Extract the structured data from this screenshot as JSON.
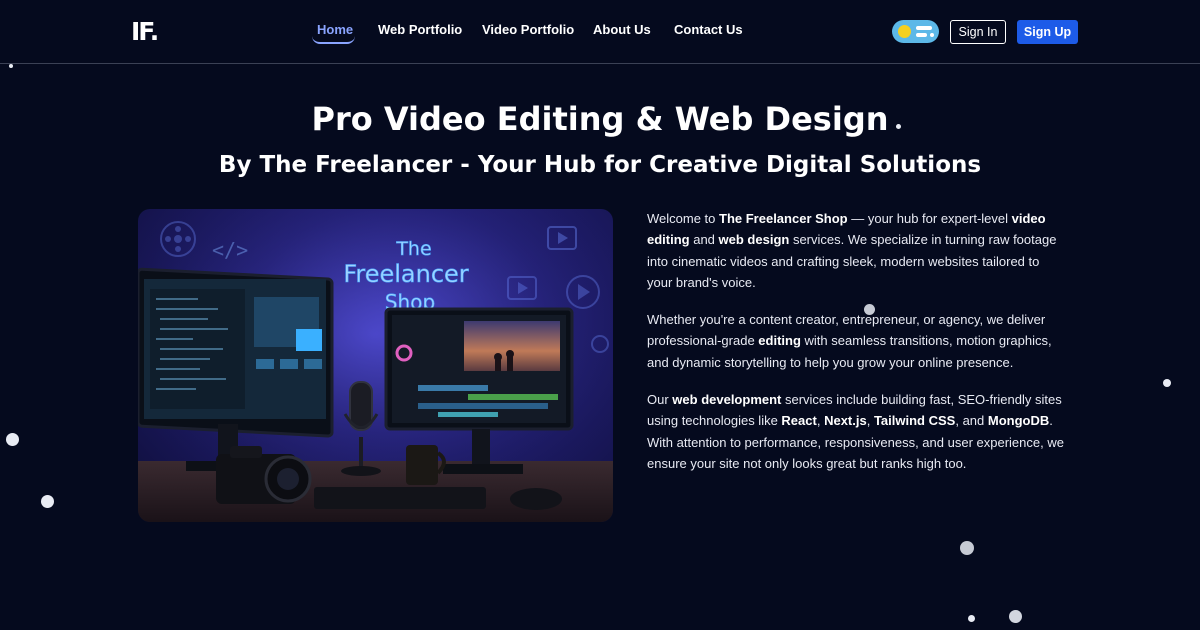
{
  "header": {
    "logo": "IF.",
    "nav": [
      {
        "label": "Home",
        "active": true
      },
      {
        "label": "Web Portfolio",
        "active": false
      },
      {
        "label": "Video Portfolio",
        "active": false
      },
      {
        "label": "About Us",
        "active": false
      },
      {
        "label": "Contact Us",
        "active": false
      }
    ],
    "signin_label": "Sign In",
    "signup_label": "Sign Up"
  },
  "hero": {
    "title": "Pro Video Editing & Web Design",
    "subtitle": "By The Freelancer - Your Hub for Creative Digital Solutions",
    "image_sign": [
      "The",
      "Freelancer",
      "Shop"
    ]
  },
  "about": {
    "p1": [
      {
        "t": "Welcome to "
      },
      {
        "t": "The Freelancer Shop",
        "b": true
      },
      {
        "t": " — your hub for expert-level "
      },
      {
        "t": "video editing",
        "b": true
      },
      {
        "t": " and "
      },
      {
        "t": "web design",
        "b": true
      },
      {
        "t": " services. We specialize in turning raw footage into cinematic videos and crafting sleek, modern websites tailored to your brand's voice."
      }
    ],
    "p2": [
      {
        "t": "Whether you're a content creator, entrepreneur, or agency, we deliver professional-grade "
      },
      {
        "t": "editing",
        "b": true
      },
      {
        "t": " with seamless transitions, motion graphics, and dynamic storytelling to help you grow your online presence."
      }
    ],
    "p3": [
      {
        "t": "Our "
      },
      {
        "t": "web development",
        "b": true
      },
      {
        "t": " services include building fast, SEO-friendly sites using technologies like "
      },
      {
        "t": "React",
        "b": true
      },
      {
        "t": ", "
      },
      {
        "t": "Next.js",
        "b": true
      },
      {
        "t": ", "
      },
      {
        "t": "Tailwind CSS",
        "b": true
      },
      {
        "t": ", and "
      },
      {
        "t": "MongoDB",
        "b": true
      },
      {
        "t": ". With attention to performance, responsiveness, and user experience, we ensure your site not only looks great but ranks high too."
      }
    ]
  },
  "colors": {
    "background": "#050a1e",
    "accent": "#8aa4ff",
    "signup": "#1d5be8",
    "neon": "#5ab8ff"
  }
}
